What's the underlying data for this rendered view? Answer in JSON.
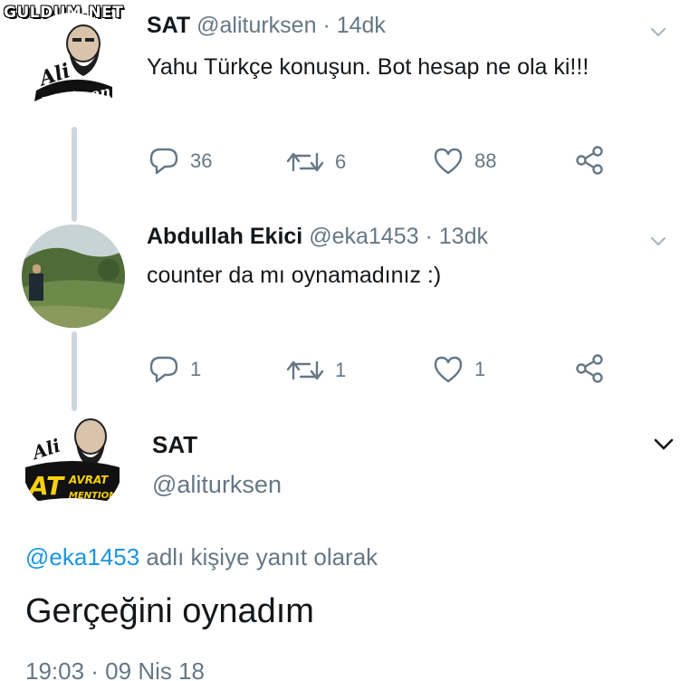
{
  "watermark": "GULDUM.NET",
  "tweets": [
    {
      "name": "SAT",
      "handle": "@aliturksen",
      "separator": "·",
      "time": "14dk",
      "text": "Yahu Türkçe konuşun. Bot hesap ne ola ki!!!",
      "avatar_text": [
        "Ali",
        "Türkşen"
      ],
      "replies": "36",
      "retweets": "6",
      "likes": "88"
    },
    {
      "name": "Abdullah Ekici",
      "handle": "@eka1453",
      "separator": "·",
      "time": "13dk",
      "text": "counter da mı oynamadınız :)",
      "replies": "1",
      "retweets": "1",
      "likes": "1"
    }
  ],
  "main_tweet": {
    "name": "SAT",
    "handle": "@aliturksen",
    "avatar_text": [
      "Ali",
      "AT",
      "AVRAT",
      "MENTION"
    ],
    "reply_mention": "@eka1453",
    "reply_suffix": "adlı kişiye yanıt olarak",
    "text": "Gerçeğini oynadım",
    "date": "19:03 · 09 Nis 18"
  },
  "colors": {
    "muted": "#657786",
    "link": "#1b95e0",
    "thread_line": "#ccd6dd",
    "text": "#14171a"
  }
}
